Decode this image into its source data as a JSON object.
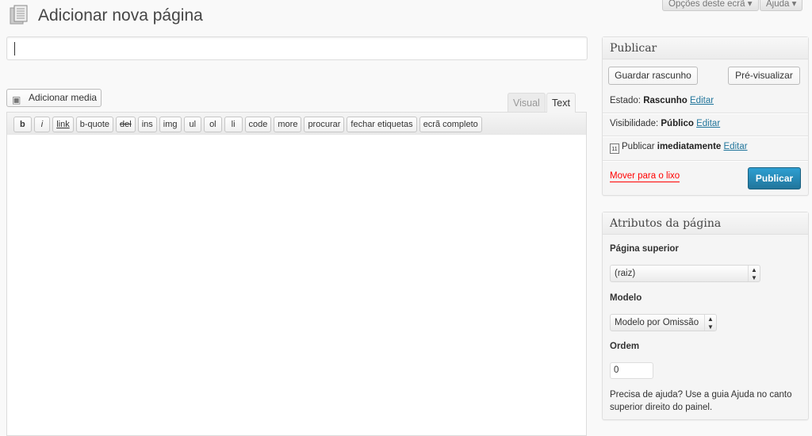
{
  "header": {
    "screen_options": "Opções deste ecrã ▾",
    "help": "Ajuda ▾",
    "title": "Adicionar nova página"
  },
  "title_input": {
    "value": ""
  },
  "editor": {
    "add_media": "Adicionar media",
    "tabs": [
      {
        "label": "Visual",
        "active": false
      },
      {
        "label": "Text",
        "active": true
      }
    ],
    "quicktags": [
      "b",
      "i",
      "link",
      "b-quote",
      "del",
      "ins",
      "img",
      "ul",
      "ol",
      "li",
      "code",
      "more",
      "procurar",
      "fechar etiquetas",
      "ecrã completo"
    ],
    "content": ""
  },
  "publish": {
    "title": "Publicar",
    "save_draft": "Guardar rascunho",
    "preview": "Pré-visualizar",
    "status_label": "Estado:",
    "status_value": "Rascunho",
    "visibility_label": "Visibilidade:",
    "visibility_value": "Público",
    "schedule_label": "Publicar",
    "schedule_value": "imediatamente",
    "edit": "Editar",
    "trash": "Mover para o lixo",
    "publish": "Publicar",
    "publish_color": "#2a8bbf",
    "trash_color": "#ff0000"
  },
  "attributes": {
    "title": "Atributos da página",
    "parent_label": "Página superior",
    "parent_value": "(raiz)",
    "template_label": "Modelo",
    "template_value": "Modelo por Omissão",
    "order_label": "Ordem",
    "order_value": "0",
    "help": "Precisa de ajuda? Use a guia Ajuda no canto superior direito do painel."
  }
}
